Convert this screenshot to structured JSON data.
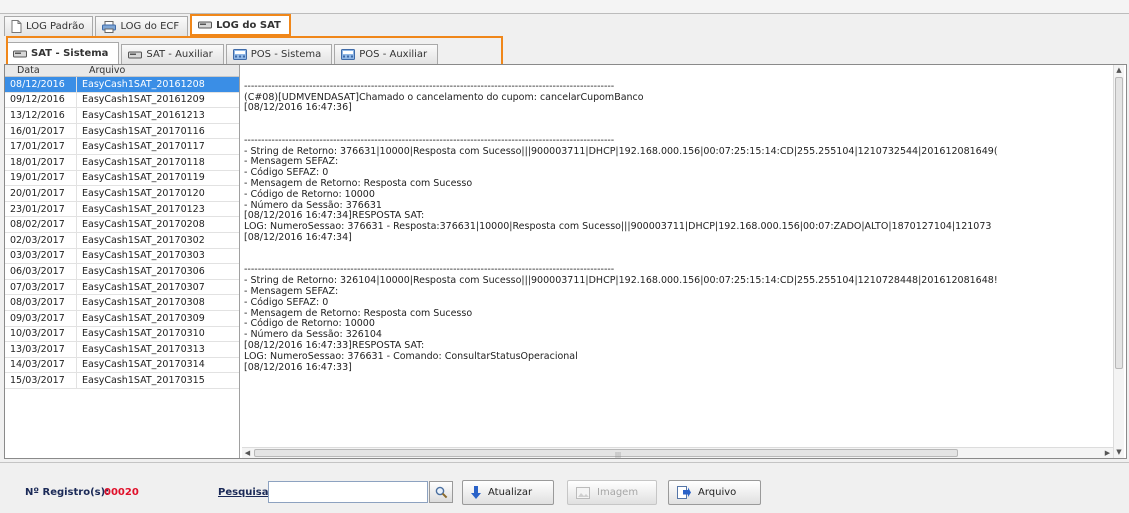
{
  "tabs_level1": [
    {
      "label": "LOG Padrão",
      "icon": "document-icon",
      "active": false
    },
    {
      "label": "LOG do ECF",
      "icon": "printer-icon",
      "active": false
    },
    {
      "label": "LOG do SAT",
      "icon": "sat-device-icon",
      "active": true
    }
  ],
  "tabs_level2": [
    {
      "label": "SAT - Sistema",
      "icon": "sat-device-icon",
      "active": true
    },
    {
      "label": "SAT - Auxiliar",
      "icon": "sat-device-icon",
      "active": false
    },
    {
      "label": "POS - Sistema",
      "icon": "pos-terminal-icon",
      "active": false
    },
    {
      "label": "POS - Auxiliar",
      "icon": "pos-terminal-icon",
      "active": false
    }
  ],
  "file_list": {
    "headers": [
      "Data",
      "Arquivo"
    ],
    "rows": [
      {
        "date": "08/12/2016",
        "file": "EasyCash1SAT_20161208",
        "selected": true
      },
      {
        "date": "09/12/2016",
        "file": "EasyCash1SAT_20161209"
      },
      {
        "date": "13/12/2016",
        "file": "EasyCash1SAT_20161213"
      },
      {
        "date": "16/01/2017",
        "file": "EasyCash1SAT_20170116"
      },
      {
        "date": "17/01/2017",
        "file": "EasyCash1SAT_20170117"
      },
      {
        "date": "18/01/2017",
        "file": "EasyCash1SAT_20170118"
      },
      {
        "date": "19/01/2017",
        "file": "EasyCash1SAT_20170119"
      },
      {
        "date": "20/01/2017",
        "file": "EasyCash1SAT_20170120"
      },
      {
        "date": "23/01/2017",
        "file": "EasyCash1SAT_20170123"
      },
      {
        "date": "08/02/2017",
        "file": "EasyCash1SAT_20170208"
      },
      {
        "date": "02/03/2017",
        "file": "EasyCash1SAT_20170302"
      },
      {
        "date": "03/03/2017",
        "file": "EasyCash1SAT_20170303"
      },
      {
        "date": "06/03/2017",
        "file": "EasyCash1SAT_20170306"
      },
      {
        "date": "07/03/2017",
        "file": "EasyCash1SAT_20170307"
      },
      {
        "date": "08/03/2017",
        "file": "EasyCash1SAT_20170308"
      },
      {
        "date": "09/03/2017",
        "file": "EasyCash1SAT_20170309"
      },
      {
        "date": "10/03/2017",
        "file": "EasyCash1SAT_20170310"
      },
      {
        "date": "13/03/2017",
        "file": "EasyCash1SAT_20170313"
      },
      {
        "date": "14/03/2017",
        "file": "EasyCash1SAT_20170314"
      },
      {
        "date": "15/03/2017",
        "file": "EasyCash1SAT_20170315"
      }
    ]
  },
  "log_lines": [
    "",
    "------------------------------------------------------------------------------------------------------------",
    "(C#08)[UDMVENDASAT]Chamado o cancelamento do cupom: cancelarCupomBanco",
    "[08/12/2016 16:47:36]",
    "",
    "",
    "------------------------------------------------------------------------------------------------------------",
    "- String de Retorno: 376631|10000|Resposta com Sucesso|||900003711|DHCP|192.168.000.156|00:07:25:15:14:CD|255.255104|1210732544|201612081649(",
    "- Mensagem SEFAZ:",
    "- Código SEFAZ: 0",
    "- Mensagem de Retorno: Resposta com Sucesso",
    "- Código de Retorno: 10000",
    "- Número da Sessão: 376631",
    "[08/12/2016 16:47:34]RESPOSTA SAT:",
    "LOG: NumeroSessao: 376631 - Resposta:376631|10000|Resposta com Sucesso|||900003711|DHCP|192.168.000.156|00:07:ZADO|ALTO|1870127104|121073",
    "[08/12/2016 16:47:34]",
    "",
    "",
    "------------------------------------------------------------------------------------------------------------",
    "- String de Retorno: 326104|10000|Resposta com Sucesso|||900003711|DHCP|192.168.000.156|00:07:25:15:14:CD|255.255104|1210728448|201612081648!",
    "- Mensagem SEFAZ:",
    "- Código SEFAZ: 0",
    "- Mensagem de Retorno: Resposta com Sucesso",
    "- Código de Retorno: 10000",
    "- Número da Sessão: 326104",
    "[08/12/2016 16:47:33]RESPOSTA SAT:",
    "LOG: NumeroSessao: 376631 - Comando: ConsultarStatusOperacional",
    "[08/12/2016 16:47:33]"
  ],
  "footer": {
    "registros_label": "Nº Registro(s):",
    "registros_value": "00020",
    "pesquisar_label": "Pesquisar:",
    "search_value": "",
    "refresh_label": "Atualizar",
    "image_label": "Imagem",
    "file_label": "Arquivo"
  },
  "colors": {
    "highlight_outline": "#f0871a",
    "selected_row": "#3a8ee6",
    "registros_value": "#e0102a",
    "label_text": "#1b2a57"
  }
}
